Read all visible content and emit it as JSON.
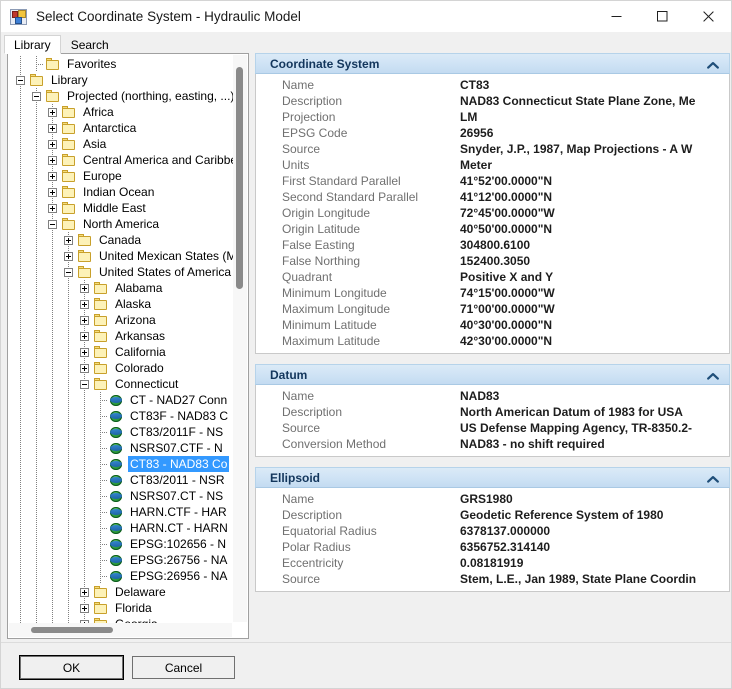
{
  "window": {
    "title": "Select Coordinate System - Hydraulic Model",
    "icon": "application-form-icon",
    "minimize_label": "Minimize",
    "maximize_label": "Maximize",
    "close_label": "Close"
  },
  "tabs": [
    {
      "label": "Library",
      "active": true
    },
    {
      "label": "Search",
      "active": false
    }
  ],
  "tree": {
    "nodes": [
      {
        "label": "Favorites",
        "depth": 1,
        "icon": "folder-icon",
        "expander": "none"
      },
      {
        "label": "Library",
        "depth": 0,
        "icon": "folder-icon",
        "expander": "minus"
      },
      {
        "label": "Projected (northing, easting, ...)",
        "depth": 1,
        "icon": "folder-icon",
        "expander": "minus"
      },
      {
        "label": "Africa",
        "depth": 2,
        "icon": "folder-icon",
        "expander": "plus"
      },
      {
        "label": "Antarctica",
        "depth": 2,
        "icon": "folder-icon",
        "expander": "plus"
      },
      {
        "label": "Asia",
        "depth": 2,
        "icon": "folder-icon",
        "expander": "plus"
      },
      {
        "label": "Central America and Caribbean",
        "depth": 2,
        "icon": "folder-icon",
        "expander": "plus"
      },
      {
        "label": "Europe",
        "depth": 2,
        "icon": "folder-icon",
        "expander": "plus"
      },
      {
        "label": "Indian Ocean",
        "depth": 2,
        "icon": "folder-icon",
        "expander": "plus"
      },
      {
        "label": "Middle East",
        "depth": 2,
        "icon": "folder-icon",
        "expander": "plus"
      },
      {
        "label": "North America",
        "depth": 2,
        "icon": "folder-icon",
        "expander": "minus"
      },
      {
        "label": "Canada",
        "depth": 3,
        "icon": "folder-icon",
        "expander": "plus"
      },
      {
        "label": "United Mexican States (M",
        "depth": 3,
        "icon": "folder-icon",
        "expander": "plus"
      },
      {
        "label": "United States of America",
        "depth": 3,
        "icon": "folder-icon",
        "expander": "minus"
      },
      {
        "label": "Alabama",
        "depth": 4,
        "icon": "folder-icon",
        "expander": "plus"
      },
      {
        "label": "Alaska",
        "depth": 4,
        "icon": "folder-icon",
        "expander": "plus"
      },
      {
        "label": "Arizona",
        "depth": 4,
        "icon": "folder-icon",
        "expander": "plus"
      },
      {
        "label": "Arkansas",
        "depth": 4,
        "icon": "folder-icon",
        "expander": "plus"
      },
      {
        "label": "California",
        "depth": 4,
        "icon": "folder-icon",
        "expander": "plus"
      },
      {
        "label": "Colorado",
        "depth": 4,
        "icon": "folder-icon",
        "expander": "plus"
      },
      {
        "label": "Connecticut",
        "depth": 4,
        "icon": "folder-icon",
        "expander": "minus"
      },
      {
        "label": "CT - NAD27 Conn",
        "depth": 5,
        "icon": "globe-icon",
        "expander": "none"
      },
      {
        "label": "CT83F - NAD83 C",
        "depth": 5,
        "icon": "globe-icon",
        "expander": "none"
      },
      {
        "label": "CT83/2011F - NS",
        "depth": 5,
        "icon": "globe-icon",
        "expander": "none"
      },
      {
        "label": "NSRS07.CTF - N",
        "depth": 5,
        "icon": "globe-icon",
        "expander": "none"
      },
      {
        "label": "CT83 - NAD83 Co",
        "depth": 5,
        "icon": "globe-icon",
        "expander": "none",
        "selected": true
      },
      {
        "label": "CT83/2011 - NSR",
        "depth": 5,
        "icon": "globe-icon",
        "expander": "none"
      },
      {
        "label": "NSRS07.CT - NS",
        "depth": 5,
        "icon": "globe-icon",
        "expander": "none"
      },
      {
        "label": "HARN.CTF - HAR",
        "depth": 5,
        "icon": "globe-icon",
        "expander": "none"
      },
      {
        "label": "HARN.CT - HARN",
        "depth": 5,
        "icon": "globe-icon",
        "expander": "none"
      },
      {
        "label": "EPSG:102656 - N",
        "depth": 5,
        "icon": "globe-icon",
        "expander": "none"
      },
      {
        "label": "EPSG:26756 - NA",
        "depth": 5,
        "icon": "globe-icon",
        "expander": "none"
      },
      {
        "label": "EPSG:26956 - NA",
        "depth": 5,
        "icon": "globe-icon",
        "expander": "none"
      },
      {
        "label": "Delaware",
        "depth": 4,
        "icon": "folder-icon",
        "expander": "plus"
      },
      {
        "label": "Florida",
        "depth": 4,
        "icon": "folder-icon",
        "expander": "plus"
      },
      {
        "label": "Georgia",
        "depth": 4,
        "icon": "folder-icon",
        "expander": "plus"
      }
    ]
  },
  "groups": [
    {
      "title": "Coordinate System",
      "collapse_icon": "chevron-up-icon",
      "rows": [
        {
          "key": "Name",
          "value": "CT83"
        },
        {
          "key": "Description",
          "value": "NAD83 Connecticut State Plane Zone, Me"
        },
        {
          "key": "Projection",
          "value": "LM"
        },
        {
          "key": "EPSG Code",
          "value": "26956"
        },
        {
          "key": "Source",
          "value": "Snyder, J.P., 1987, Map Projections - A W"
        },
        {
          "key": "Units",
          "value": "Meter"
        },
        {
          "key": "First Standard Parallel",
          "value": "41°52'00.0000\"N"
        },
        {
          "key": "Second Standard Parallel",
          "value": "41°12'00.0000\"N"
        },
        {
          "key": "Origin Longitude",
          "value": "72°45'00.0000\"W"
        },
        {
          "key": "Origin Latitude",
          "value": "40°50'00.0000\"N"
        },
        {
          "key": "False Easting",
          "value": "304800.6100"
        },
        {
          "key": "False Northing",
          "value": "152400.3050"
        },
        {
          "key": "Quadrant",
          "value": "Positive X and Y"
        },
        {
          "key": "Minimum Longitude",
          "value": "74°15'00.0000\"W"
        },
        {
          "key": "Maximum Longitude",
          "value": "71°00'00.0000\"W"
        },
        {
          "key": "Minimum Latitude",
          "value": "40°30'00.0000\"N"
        },
        {
          "key": "Maximum Latitude",
          "value": "42°30'00.0000\"N"
        }
      ]
    },
    {
      "title": "Datum",
      "collapse_icon": "chevron-up-icon",
      "rows": [
        {
          "key": "Name",
          "value": "NAD83"
        },
        {
          "key": "Description",
          "value": "North American Datum of 1983 for USA"
        },
        {
          "key": "Source",
          "value": "US Defense Mapping Agency, TR-8350.2-"
        },
        {
          "key": "Conversion Method",
          "value": "NAD83 - no shift required"
        }
      ]
    },
    {
      "title": "Ellipsoid",
      "collapse_icon": "chevron-up-icon",
      "rows": [
        {
          "key": "Name",
          "value": "GRS1980"
        },
        {
          "key": "Description",
          "value": "Geodetic Reference System of 1980"
        },
        {
          "key": "Equatorial Radius",
          "value": "6378137.000000"
        },
        {
          "key": "Polar Radius",
          "value": "6356752.314140"
        },
        {
          "key": "Eccentricity",
          "value": "0.08181919"
        },
        {
          "key": "Source",
          "value": "Stem, L.E., Jan 1989, State Plane Coordin"
        }
      ]
    }
  ],
  "footer": {
    "ok_label": "OK",
    "cancel_label": "Cancel"
  },
  "colors": {
    "selection": "#3399ff",
    "group_header_text": "#13365c",
    "group_header_bg": "#cfe3f5",
    "value_text": "#1d1d1d",
    "key_text": "#707070"
  }
}
